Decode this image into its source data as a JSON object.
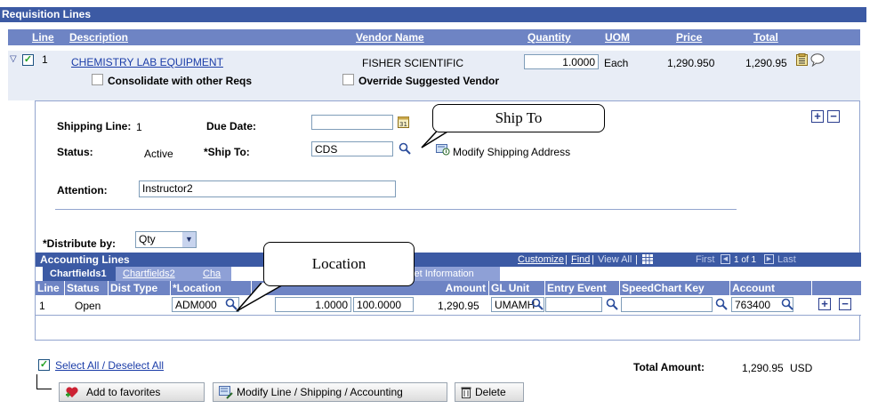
{
  "section_title": "Requisition Lines",
  "columns": {
    "line": "Line",
    "description": "Description",
    "vendor_name": "Vendor Name",
    "quantity": "Quantity",
    "uom": "UOM",
    "price": "Price",
    "total": "Total"
  },
  "line_row": {
    "line_no": "1",
    "description": "CHEMISTRY LAB EQUIPMENT",
    "vendor": "FISHER SCIENTIFIC",
    "quantity": "1.0000",
    "uom": "Each",
    "price": "1,290.950",
    "total": "1,290.95",
    "consolidate_label": "Consolidate with other Reqs",
    "override_label": "Override Suggested Vendor"
  },
  "shipping": {
    "shipping_line_label": "Shipping Line:",
    "shipping_line_value": "1",
    "due_date_label": "Due Date:",
    "due_date_value": "",
    "status_label": "Status:",
    "status_value": "Active",
    "ship_to_label": "*Ship To:",
    "ship_to_value": "CDS",
    "modify_shipping_label": "Modify Shipping Address",
    "attention_label": "Attention:",
    "attention_value": "Instructor2",
    "distribute_label": "*Distribute by:",
    "distribute_value": "Qty"
  },
  "callouts": {
    "ship_to": "Ship To",
    "location": "Location"
  },
  "accounting": {
    "title": "Accounting Lines",
    "nav": {
      "customize": "Customize",
      "find": "Find",
      "view_all": "View All",
      "first": "First",
      "pager": "1 of 1",
      "last": "Last"
    },
    "tabs": [
      "Chartfields1",
      "Chartfields2",
      "Cha",
      "set Information"
    ],
    "headers": {
      "line": "Line",
      "status": "Status",
      "dist_type": "Dist Type",
      "location": "*Location",
      "amount": "Amount",
      "gl_unit": "GL Unit",
      "entry_event": "Entry Event",
      "speedchart": "SpeedChart Key",
      "account": "Account"
    },
    "row": {
      "line": "1",
      "status": "Open",
      "location": "ADM000",
      "quantity": "1.0000",
      "percent": "100.0000",
      "amount": "1,290.95",
      "gl_unit": "UMAMH",
      "entry_event": "",
      "speedchart": "",
      "account": "763400"
    }
  },
  "footer": {
    "select_all": "Select All / Deselect All",
    "total_amount_label": "Total Amount:",
    "total_amount_value": "1,290.95",
    "currency": "USD",
    "add_favorites": "Add to favorites",
    "modify_line": "Modify Line / Shipping / Accounting",
    "delete": "Delete"
  },
  "colors": {
    "header_bar": "#3c5aa4",
    "sub_header": "#6e84c4",
    "row_bg": "#e8edf6",
    "panel_border": "#93a5cf",
    "tab_active": "#3c5aa4",
    "tab_inactive": "#8ea0d6"
  }
}
